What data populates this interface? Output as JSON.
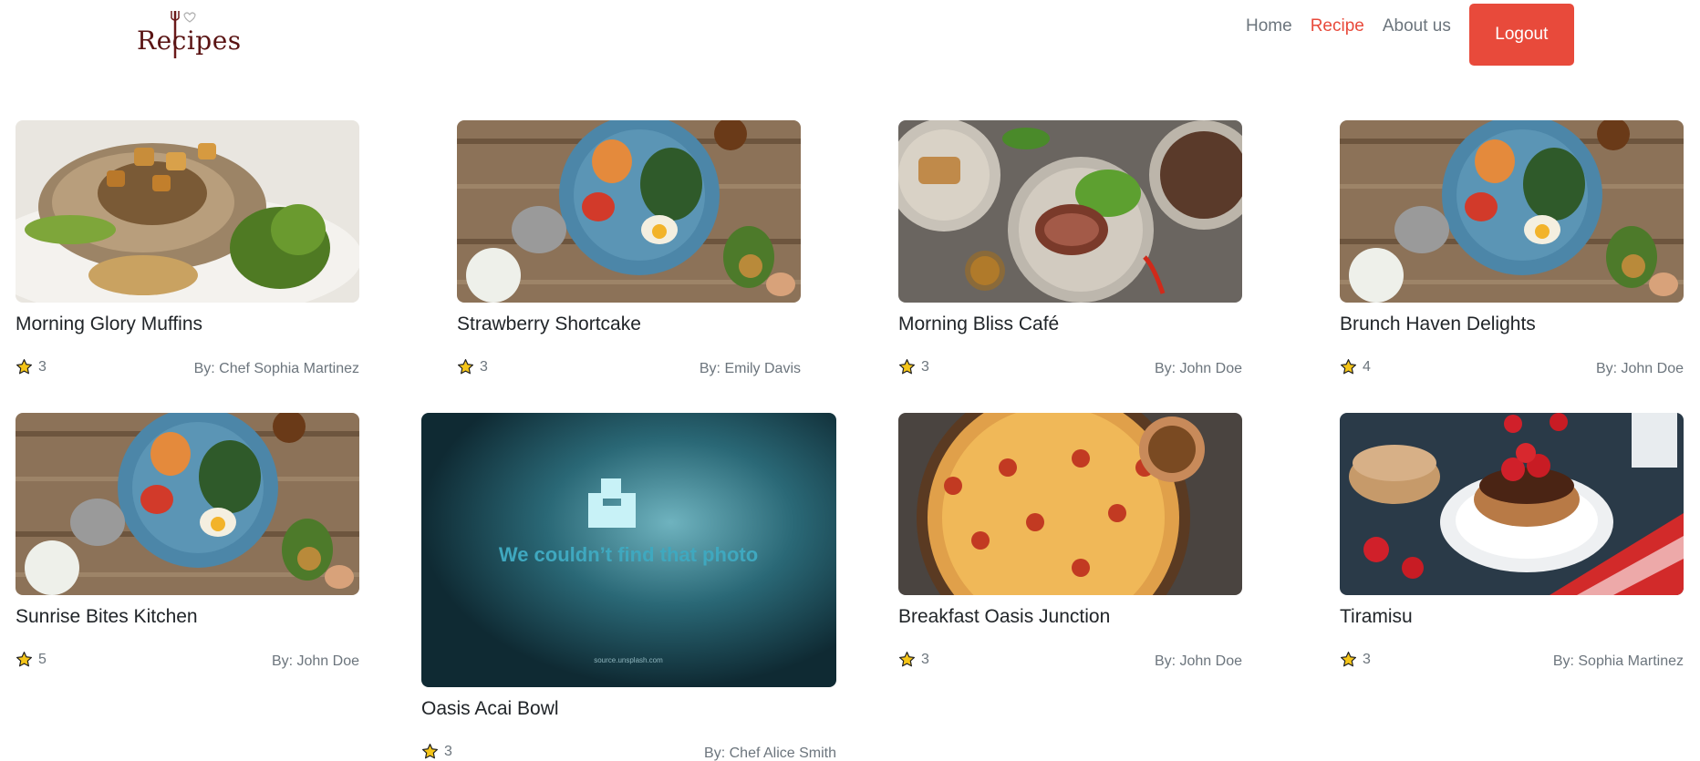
{
  "header": {
    "logo_text": "Recipes",
    "nav": [
      {
        "label": "Home",
        "active": false
      },
      {
        "label": "Recipe",
        "active": true
      },
      {
        "label": "About us",
        "active": false
      }
    ],
    "logout_label": "Logout"
  },
  "colors": {
    "accent": "#e84a3b",
    "muted": "#6c757d",
    "star": "#f5c518"
  },
  "recipes": [
    {
      "title": "Morning Glory Muffins",
      "rating": "3",
      "author": "By: Chef Sophia Martinez",
      "image": "grilled-chicken-photo"
    },
    {
      "title": "Strawberry Shortcake",
      "rating": "3",
      "author": "By: Emily Davis",
      "image": "salad-bowl-photo"
    },
    {
      "title": "Morning Bliss Café",
      "rating": "3",
      "author": "By: John Doe",
      "image": "steak-plates-photo"
    },
    {
      "title": "Brunch Haven Delights",
      "rating": "4",
      "author": "By: John Doe",
      "image": "salad-bowl-photo"
    },
    {
      "title": "Sunrise Bites Kitchen",
      "rating": "5",
      "author": "By: John Doe",
      "image": "salad-bowl-photo"
    },
    {
      "title": "Oasis Acai Bowl",
      "rating": "3",
      "author": "By: Chef Alice Smith",
      "image": "missing-photo-placeholder",
      "placeholder_text": "We couldn’t find that photo",
      "placeholder_source": "source.unsplash.com"
    },
    {
      "title": "Breakfast Oasis Junction",
      "rating": "3",
      "author": "By: John Doe",
      "image": "pizza-photo"
    },
    {
      "title": "Tiramisu",
      "rating": "3",
      "author": "By: Sophia Martinez",
      "image": "pancakes-photo"
    }
  ]
}
